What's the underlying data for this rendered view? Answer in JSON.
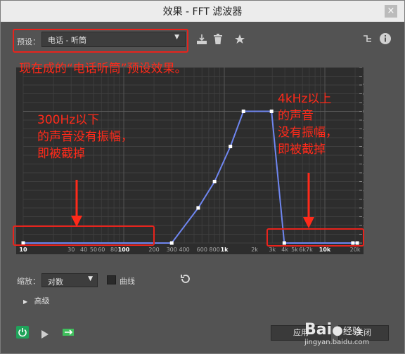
{
  "window": {
    "title": "效果 - FFT 滤波器",
    "close_glyph": "×"
  },
  "toolbar": {
    "preset_label": "预设：",
    "preset_value": "电话 - 听筒",
    "icons": [
      "save-preset-icon",
      "delete-icon",
      "star-icon",
      "routing-icon",
      "info-icon"
    ]
  },
  "annotations": {
    "top": "现在成的“电话听筒”预设效果。",
    "left_lines": [
      "300Hz以下",
      "的声音没有振幅，",
      "即被截掉"
    ],
    "right_lines": [
      "4kHz以上",
      "的声音",
      "没有振幅，",
      "即被截掉"
    ]
  },
  "graph": {
    "x_ticks": [
      {
        "f": 10,
        "label": "10",
        "bold": true
      },
      {
        "f": 30,
        "label": "30"
      },
      {
        "f": 40,
        "label": "40"
      },
      {
        "f": 50,
        "label": "50"
      },
      {
        "f": 60,
        "label": "60"
      },
      {
        "f": 80,
        "label": "80"
      },
      {
        "f": 100,
        "label": "100",
        "bold": true
      },
      {
        "f": 200,
        "label": "200"
      },
      {
        "f": 300,
        "label": "300"
      },
      {
        "f": 400,
        "label": "400"
      },
      {
        "f": 600,
        "label": "600"
      },
      {
        "f": 800,
        "label": "800"
      },
      {
        "f": 1000,
        "label": "1k",
        "bold": true
      },
      {
        "f": 2000,
        "label": "2k"
      },
      {
        "f": 3000,
        "label": "3k"
      },
      {
        "f": 4000,
        "label": "4k"
      },
      {
        "f": 5000,
        "label": "5k"
      },
      {
        "f": 6000,
        "label": "6k"
      },
      {
        "f": 7000,
        "label": "7k"
      },
      {
        "f": 10000,
        "label": "10k",
        "bold": true
      },
      {
        "f": 20000,
        "label": "20k"
      }
    ],
    "y_ticks": [
      "15",
      "12",
      "9",
      "6",
      "3",
      "0",
      "-3",
      "-6",
      "-9",
      "-12",
      "-15",
      "-18",
      "-24",
      "-30",
      "-36",
      "-42",
      "-48",
      "-54",
      "-66",
      "-84",
      "-∞"
    ],
    "points": [
      {
        "f": 10,
        "db": "-inf"
      },
      {
        "f": 300,
        "db": "-inf"
      },
      {
        "f": 550,
        "db": -48
      },
      {
        "f": 800,
        "db": -30
      },
      {
        "f": 1150,
        "db": -12
      },
      {
        "f": 1550,
        "db": 0
      },
      {
        "f": 2950,
        "db": 0
      },
      {
        "f": 3950,
        "db": "-inf"
      },
      {
        "f": 19000,
        "db": "-inf"
      },
      {
        "f": 21000,
        "db": "-inf"
      }
    ]
  },
  "zoom": {
    "label": "缩放：",
    "value": "对数"
  },
  "curve_label": "曲线",
  "advanced_label": "高级",
  "buttons": {
    "apply": "应用",
    "close": "关闭"
  },
  "watermark": {
    "brand": "Bai",
    "brand_suffix": "经验",
    "url": "jingyan.baidu.com"
  },
  "colors": {
    "curve": "#6f86f0",
    "annotation": "#ff2a1a",
    "power_on": "#1fa35a"
  }
}
